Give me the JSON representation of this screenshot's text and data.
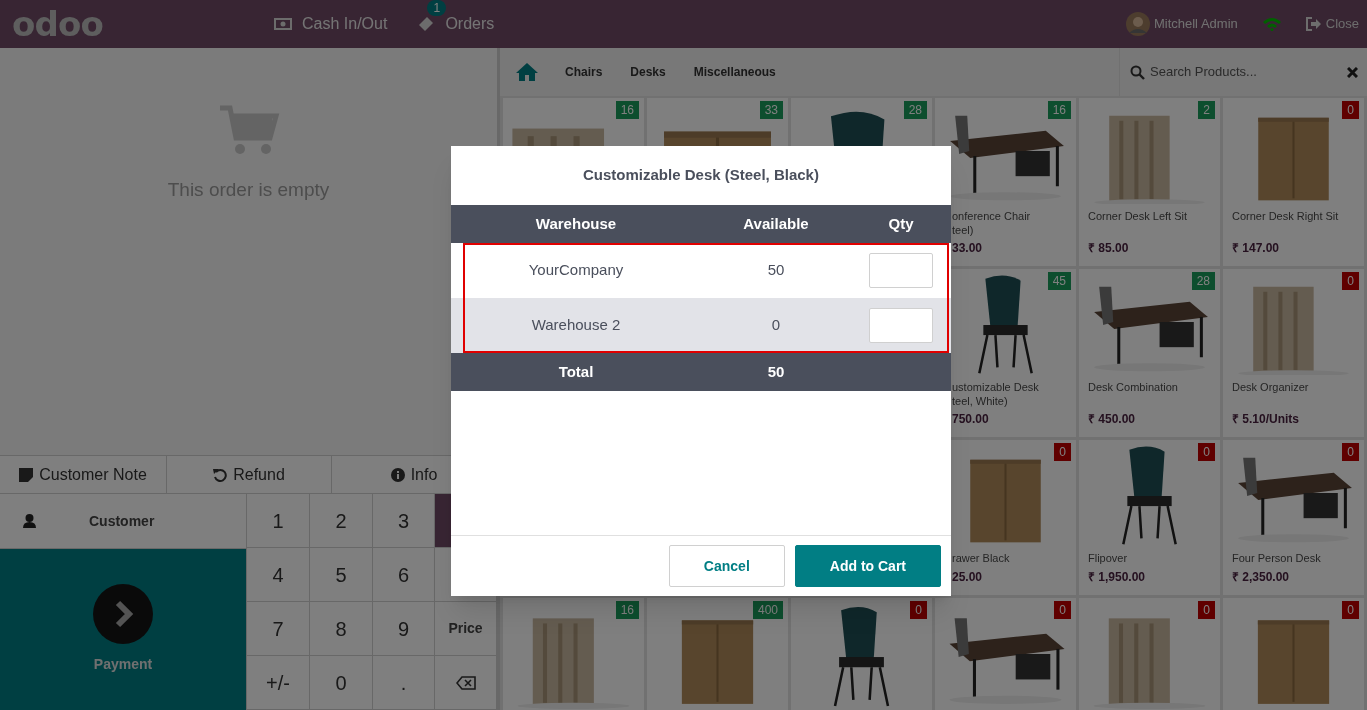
{
  "header": {
    "logo": "odoo",
    "nav": [
      {
        "kind": "cash",
        "label": "Cash In/Out"
      },
      {
        "kind": "orders",
        "label": "Orders",
        "badge": "1"
      }
    ],
    "user": "Mitchell Admin",
    "close": "Close"
  },
  "categories": {
    "items": [
      "Chairs",
      "Desks",
      "Miscellaneous"
    ],
    "search_placeholder": "Search Products..."
  },
  "order": {
    "empty_text": "This order is empty"
  },
  "controls": [
    {
      "kind": "note",
      "label": "Customer Note"
    },
    {
      "kind": "refund",
      "label": "Refund"
    },
    {
      "kind": "info",
      "label": "Info"
    }
  ],
  "customer": "Customer",
  "payment": "Payment",
  "numpad": [
    {
      "kind": "digit",
      "label": "1"
    },
    {
      "kind": "digit",
      "label": "2"
    },
    {
      "kind": "digit",
      "label": "3"
    },
    {
      "kind": "mode",
      "selected": true
    },
    {
      "kind": "digit",
      "label": "4"
    },
    {
      "kind": "digit",
      "label": "5"
    },
    {
      "kind": "digit",
      "label": "6"
    },
    {
      "kind": "mode",
      "selected": false
    },
    {
      "kind": "digit",
      "label": "7"
    },
    {
      "kind": "digit",
      "label": "8"
    },
    {
      "kind": "digit",
      "label": "9"
    },
    {
      "kind": "mode",
      "label": "Price",
      "selected": false
    },
    {
      "kind": "digit",
      "label": "+/-"
    },
    {
      "kind": "digit",
      "label": "0"
    },
    {
      "kind": "digit",
      "label": "."
    },
    {
      "kind": "backspace"
    }
  ],
  "products": {
    "rows": [
      {
        "cards": [
          {
            "stock": "16",
            "in_stock": true
          },
          {
            "stock": "33",
            "in_stock": true
          },
          {
            "stock": "28",
            "in_stock": true
          },
          {
            "stock": "16",
            "in_stock": true,
            "name": "onference Chair\nteel)",
            "price": "33.00",
            "cut": true
          },
          {
            "stock": "2",
            "in_stock": true,
            "name": "Corner Desk Left Sit",
            "price": "₹ 85.00",
            "cut": false
          },
          {
            "stock": "0",
            "in_stock": false,
            "name": "Corner Desk Right Sit",
            "price": "₹ 147.00",
            "cut": false
          }
        ]
      },
      {
        "cards": [
          {
            "stock": "45",
            "in_stock": true,
            "name": "ustomizable Desk\nteel, White)",
            "price": "750.00",
            "cut": true
          },
          {
            "stock": "28",
            "in_stock": true,
            "name": "Desk Combination",
            "price": "₹ 450.00",
            "cut": false
          },
          {
            "stock": "0",
            "in_stock": false,
            "name": "Desk Organizer",
            "price": "₹ 5.10/Units",
            "cut": false
          }
        ]
      },
      {
        "cards": [
          {
            "stock": "0",
            "in_stock": false,
            "name": "rawer Black",
            "price": "25.00",
            "cut": true
          },
          {
            "stock": "0",
            "in_stock": false,
            "name": "Flipover",
            "price": "₹ 1,950.00",
            "cut": false
          },
          {
            "stock": "0",
            "in_stock": false,
            "name": "Four Person Desk",
            "price": "₹ 2,350.00",
            "cut": false
          }
        ]
      },
      {
        "cards": [
          {
            "stock": "16",
            "in_stock": true
          },
          {
            "stock": "400",
            "in_stock": true
          },
          {
            "stock": "0",
            "in_stock": false
          },
          {
            "stock": "0",
            "in_stock": false
          },
          {
            "stock": "0",
            "in_stock": false
          },
          {
            "stock": "0",
            "in_stock": false
          }
        ]
      }
    ]
  },
  "dialog": {
    "title": "Customizable Desk (Steel, Black)",
    "columns": [
      "Warehouse",
      "Available",
      "Qty"
    ],
    "rows": [
      {
        "warehouse": "YourCompany",
        "available": "50"
      },
      {
        "warehouse": "Warehouse 2",
        "available": "0"
      }
    ],
    "total": {
      "label": "Total",
      "available": "50"
    },
    "buttons": [
      {
        "kind": "secondary",
        "label": "Cancel"
      },
      {
        "kind": "primary",
        "label": "Add to Cart"
      }
    ]
  }
}
